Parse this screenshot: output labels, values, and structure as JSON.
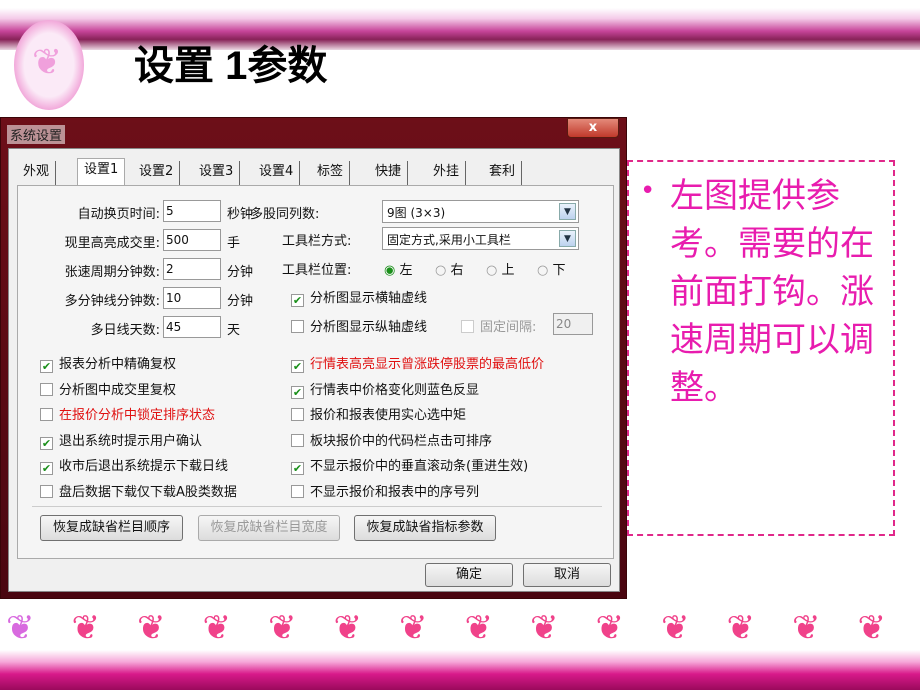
{
  "slide": {
    "title": "设置 1参数",
    "note": "左图提供参考。需要的在前面打钩。涨速周期可以调整。",
    "bullet": "•",
    "accent": "#e81cae"
  },
  "dialog": {
    "title": "系统设置",
    "close": "x",
    "tabs": [
      "外观",
      "设置1",
      "设置2",
      "设置3",
      "设置4",
      "标签",
      "快捷",
      "外挂",
      "套利"
    ],
    "active_tab": "设置1",
    "fields": [
      {
        "label": "自动换页时间:",
        "value": "5",
        "unit": "秒钟"
      },
      {
        "label": "现里高亮成交里:",
        "value": "500",
        "unit": "手"
      },
      {
        "label": "张速周期分钟数:",
        "value": "2",
        "unit": "分钟"
      },
      {
        "label": "多分钟线分钟数:",
        "value": "10",
        "unit": "分钟"
      },
      {
        "label": "多日线天数:",
        "value": "45",
        "unit": "天"
      }
    ],
    "multi_cols": {
      "label": "多股同列数:",
      "value": "9图 (3×3)"
    },
    "toolbar_mode": {
      "label": "工具栏方式:",
      "value": "固定方式,采用小工具栏"
    },
    "toolbar_pos": {
      "label": "工具栏位置:",
      "options": [
        "左",
        "右",
        "上",
        "下"
      ],
      "selected": "左"
    },
    "grid_h": {
      "label": "分析图显示横轴虚线",
      "checked": true
    },
    "grid_v": {
      "label": "分析图显示纵轴虚线",
      "checked": false
    },
    "fixed_interval": {
      "label": "固定间隔:",
      "value": "20"
    },
    "left_checks": [
      {
        "label": "报表分析中精确复权",
        "checked": true
      },
      {
        "label": "分析图中成交里复权",
        "checked": false
      },
      {
        "label": "在报价分析中锁定排序状态",
        "checked": false,
        "red": true
      },
      {
        "label": "退出系统时提示用户确认",
        "checked": true
      },
      {
        "label": "收市后退出系统提示下载日线",
        "checked": true
      },
      {
        "label": "盘后数据下载仅下载A股类数据",
        "checked": false
      }
    ],
    "right_checks": [
      {
        "label": "行情表高亮显示曾涨跌停股票的最高低价",
        "checked": true,
        "red": true
      },
      {
        "label": "行情表中价格变化则蓝色反显",
        "checked": true
      },
      {
        "label": "报价和报表使用实心选中矩",
        "checked": false
      },
      {
        "label": "板块报价中的代码栏点击可排序",
        "checked": false
      },
      {
        "label": "不显示报价中的垂直滚动条(重进生效)",
        "checked": true
      },
      {
        "label": "不显示报价和报表中的序号列",
        "checked": false
      }
    ],
    "buttons": {
      "restore_order": "恢复成缺省栏目顺序",
      "restore_width": "恢复成缺省栏目宽度",
      "restore_params": "恢复成缺省指标参数",
      "ok": "确定",
      "cancel": "取消"
    }
  }
}
